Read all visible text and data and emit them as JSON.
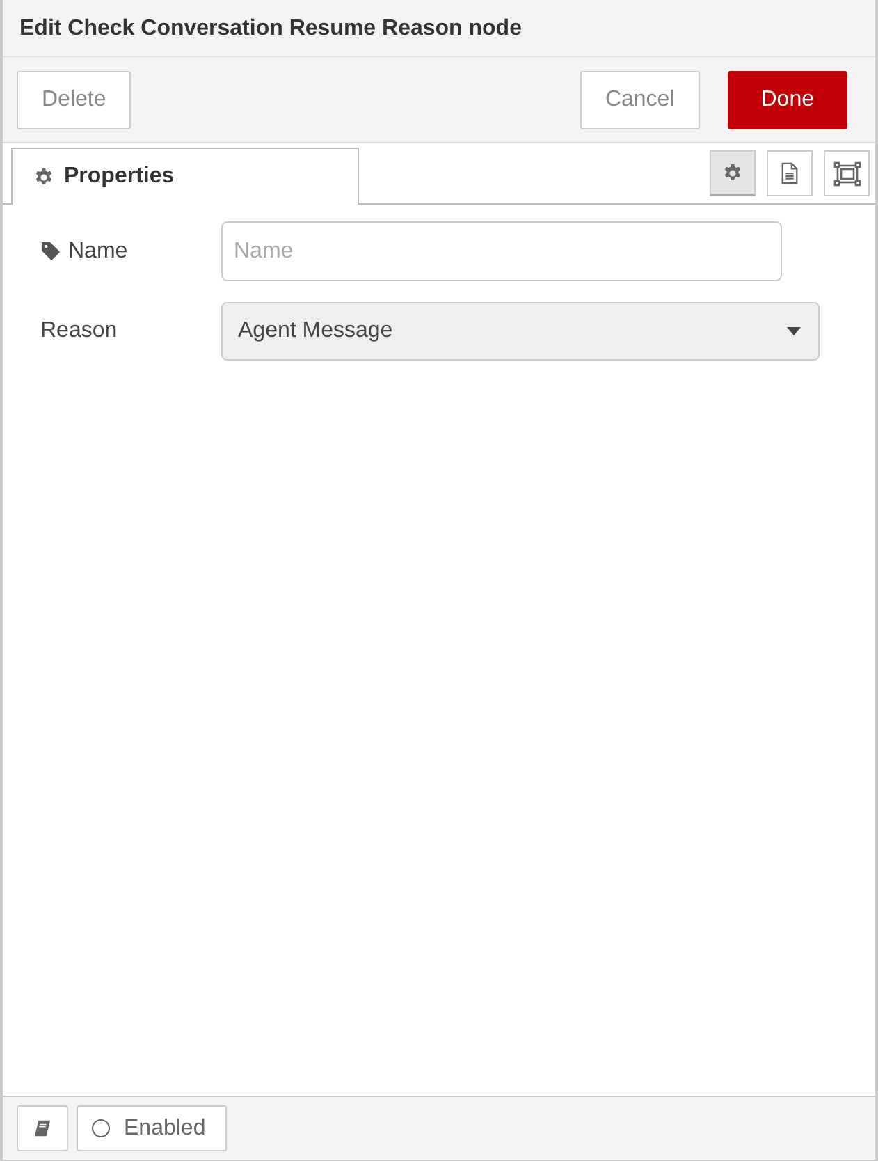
{
  "window": {
    "title": "Edit Check Conversation Resume Reason node"
  },
  "left_buttons": [
    {
      "label": "Delete",
      "kind": "plain"
    }
  ],
  "right_buttons": [
    {
      "label": "Cancel",
      "kind": "plain"
    },
    {
      "label": "Done",
      "kind": "primary"
    }
  ],
  "tabs": [
    {
      "label": "Properties",
      "selected": true
    }
  ],
  "side_tabs": [
    {
      "kind": "settings",
      "selected": true
    },
    {
      "kind": "description",
      "selected": false
    },
    {
      "kind": "appearance",
      "selected": false
    }
  ],
  "fields": [
    {
      "label": "Name",
      "kind": "text",
      "placeholder": "Name"
    },
    {
      "label": "Reason",
      "kind": "select",
      "value": "Agent Message"
    }
  ],
  "footer": {
    "enabled": true,
    "enabled_label": "Enabled"
  }
}
